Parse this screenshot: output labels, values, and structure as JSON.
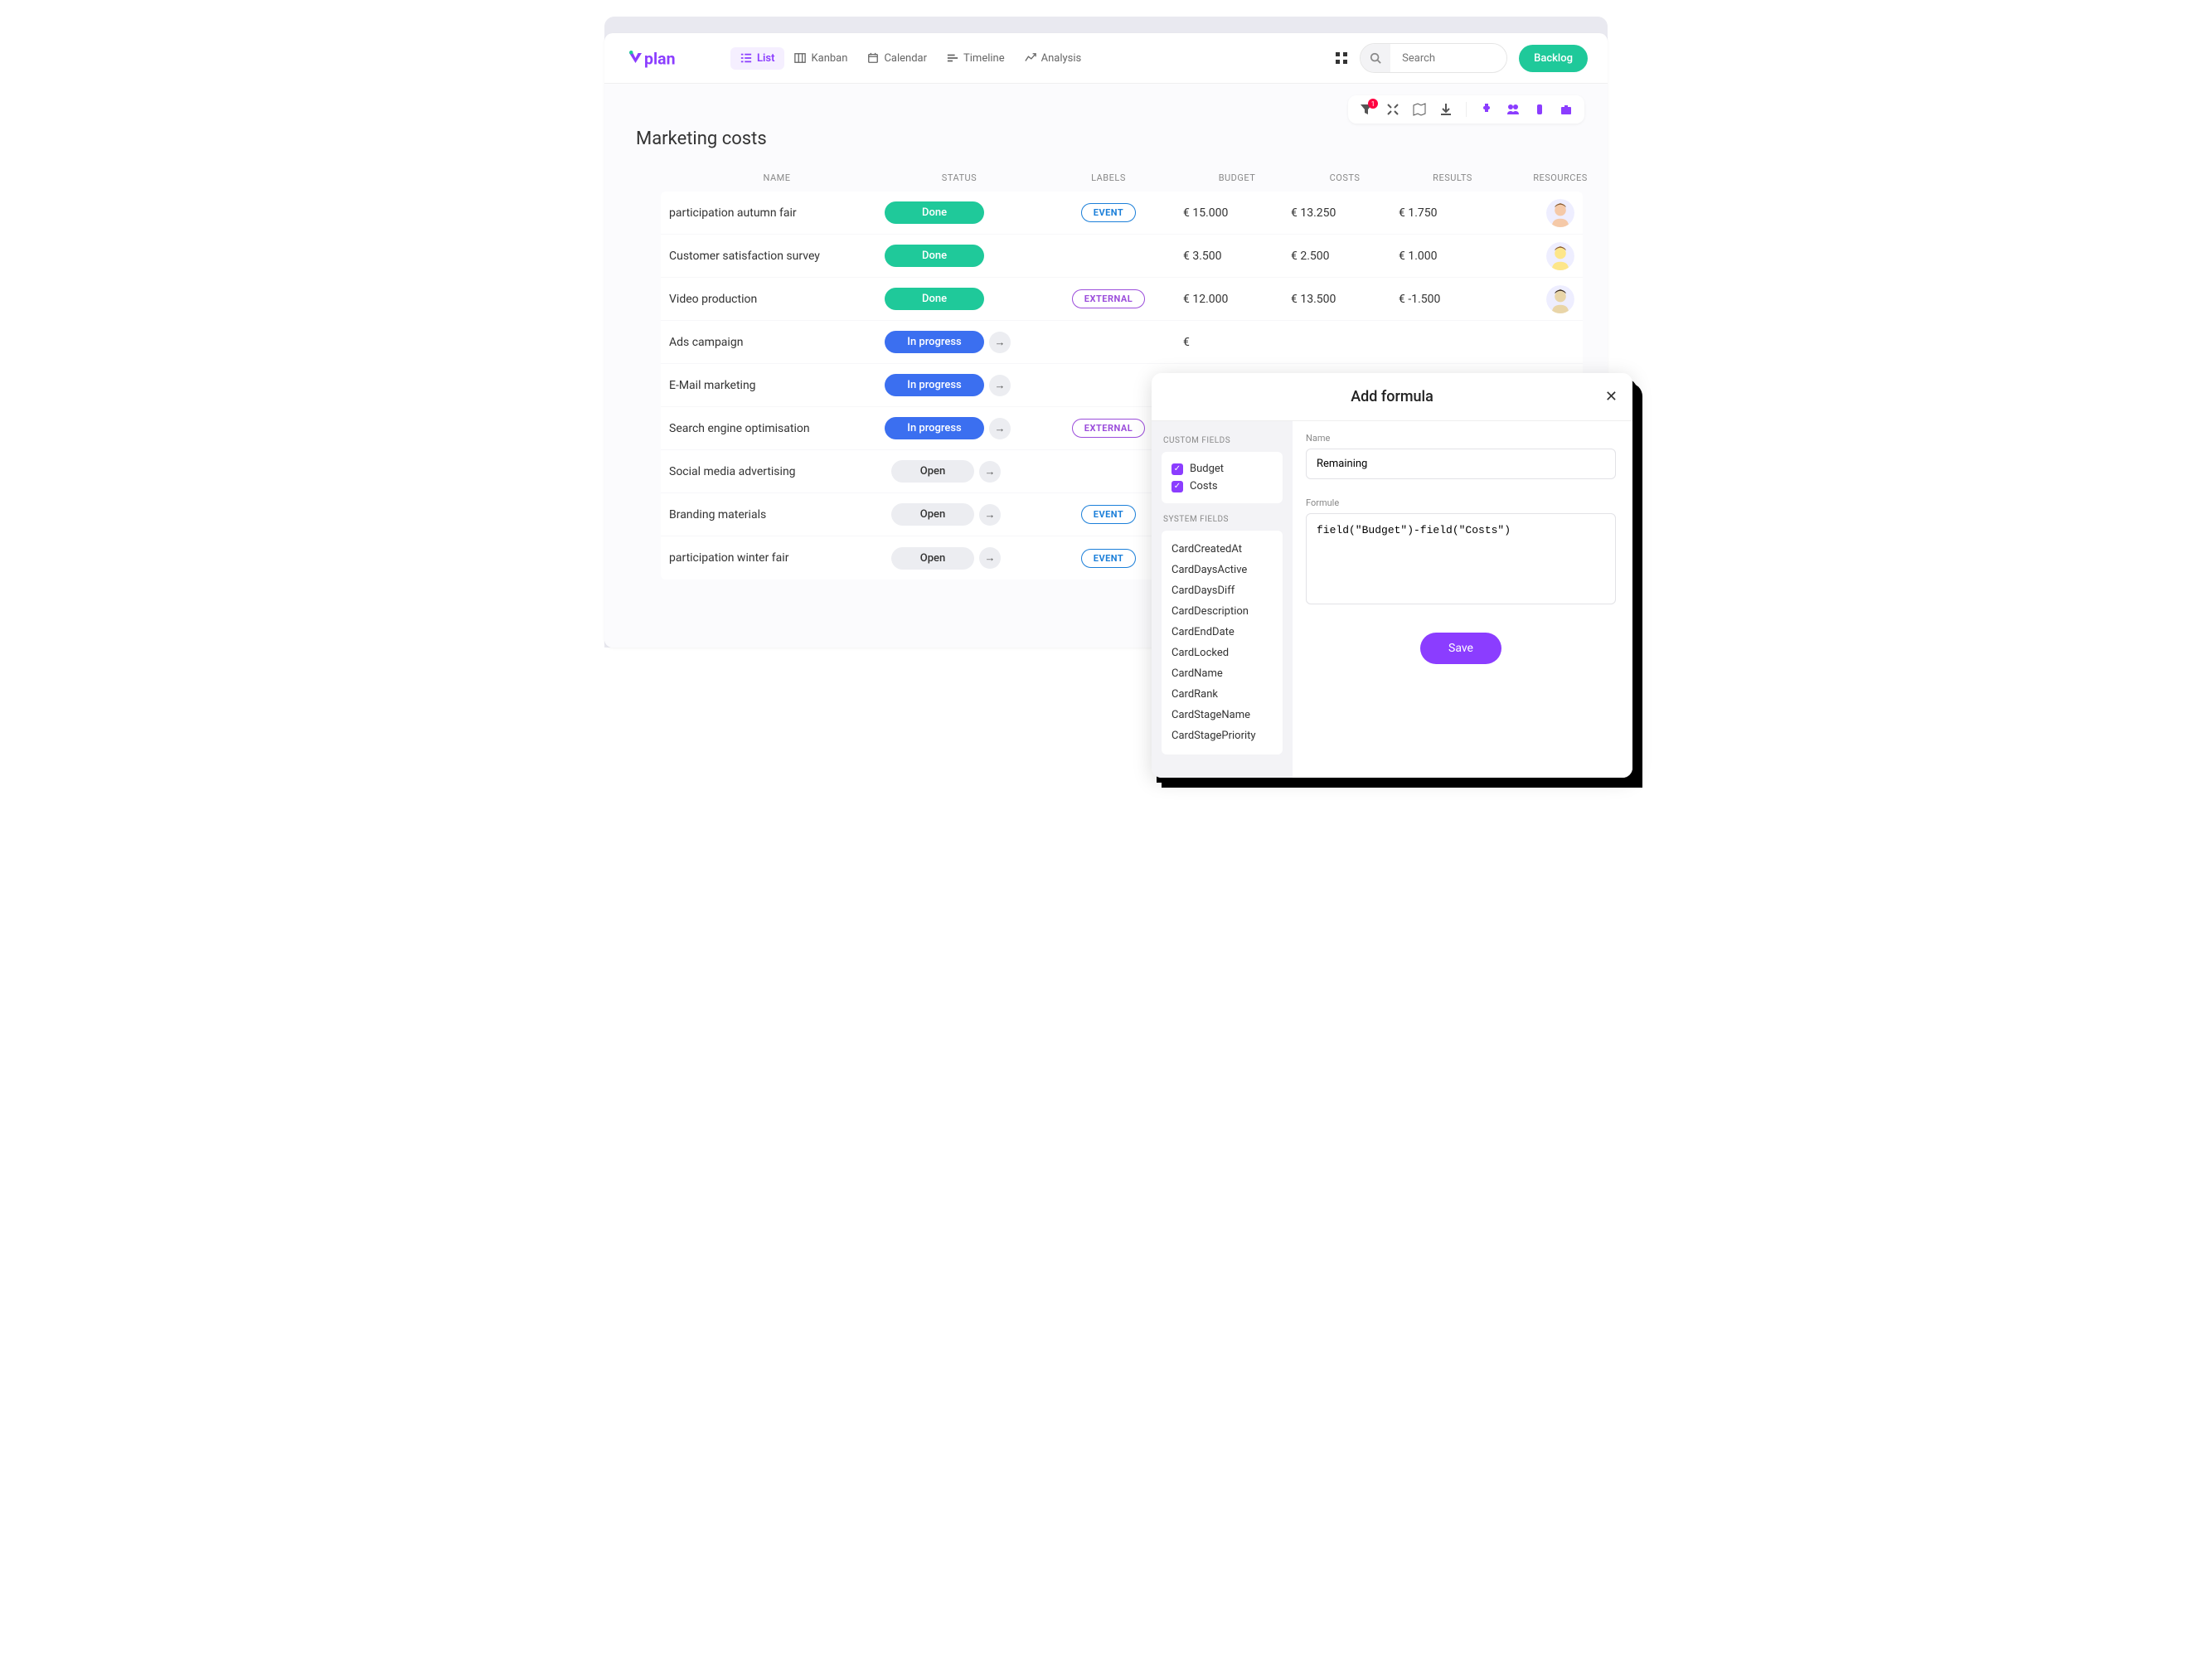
{
  "brand": "vplan",
  "views": {
    "items": [
      {
        "label": "List",
        "active": true
      },
      {
        "label": "Kanban",
        "active": false
      },
      {
        "label": "Calendar",
        "active": false
      },
      {
        "label": "Timeline",
        "active": false
      },
      {
        "label": "Analysis",
        "active": false
      }
    ]
  },
  "search": {
    "placeholder": "Search"
  },
  "backlog_label": "Backlog",
  "filter_badge": "1",
  "page_title": "Marketing costs",
  "columns": {
    "name": "NAME",
    "status": "STATUS",
    "labels": "LABELS",
    "budget": "BUDGET",
    "costs": "COSTS",
    "results": "RESULTS",
    "resources": "RESOURCES"
  },
  "status_labels": {
    "done": "Done",
    "progress": "In progress",
    "open": "Open"
  },
  "label_text": {
    "event": "EVENT",
    "external": "EXTERNAL"
  },
  "rows": [
    {
      "name": "participation autumn fair",
      "status": "done",
      "label": "event",
      "budget": "€ 15.000",
      "costs": "€ 13.250",
      "results": "€ 1.750",
      "avatar": 1
    },
    {
      "name": "Customer satisfaction survey",
      "status": "done",
      "label": "",
      "budget": "€ 3.500",
      "costs": "€ 2.500",
      "results": "€ 1.000",
      "avatar": 2
    },
    {
      "name": "Video production",
      "status": "done",
      "label": "external",
      "budget": "€ 12.000",
      "costs": "€ 13.500",
      "results": "€ -1.500",
      "avatar": 3
    },
    {
      "name": "Ads campaign",
      "status": "progress",
      "label": "",
      "budget": "€",
      "costs": "",
      "results": "",
      "avatar": 0
    },
    {
      "name": "E-Mail marketing",
      "status": "progress",
      "label": "",
      "budget": "€",
      "costs": "",
      "results": "",
      "avatar": 0
    },
    {
      "name": "Search engine optimisation",
      "status": "progress",
      "label": "external",
      "budget": "€",
      "costs": "",
      "results": "",
      "avatar": 0
    },
    {
      "name": "Social media advertising",
      "status": "open",
      "label": "",
      "budget": "€",
      "costs": "",
      "results": "",
      "avatar": 0
    },
    {
      "name": "Branding materials",
      "status": "open",
      "label": "event",
      "budget": "€",
      "costs": "",
      "results": "",
      "avatar": 0
    },
    {
      "name": "participation winter fair",
      "status": "open",
      "label": "event",
      "budget": "€",
      "costs": "",
      "results": "",
      "avatar": 0
    }
  ],
  "modal": {
    "title": "Add formula",
    "custom_fields_label": "CUSTOM FIELDS",
    "custom_fields": [
      "Budget",
      "Costs"
    ],
    "system_fields_label": "SYSTEM FIELDS",
    "system_fields": [
      "CardCreatedAt",
      "CardDaysActive",
      "CardDaysDiff",
      "CardDescription",
      "CardEndDate",
      "CardLocked",
      "CardName",
      "CardRank",
      "CardStageName",
      "CardStagePriority"
    ],
    "name_label": "Name",
    "name_value": "Remaining",
    "formula_label": "Formule",
    "formula_value": "field(\"Budget\")-field(\"Costs\")",
    "save_label": "Save"
  }
}
